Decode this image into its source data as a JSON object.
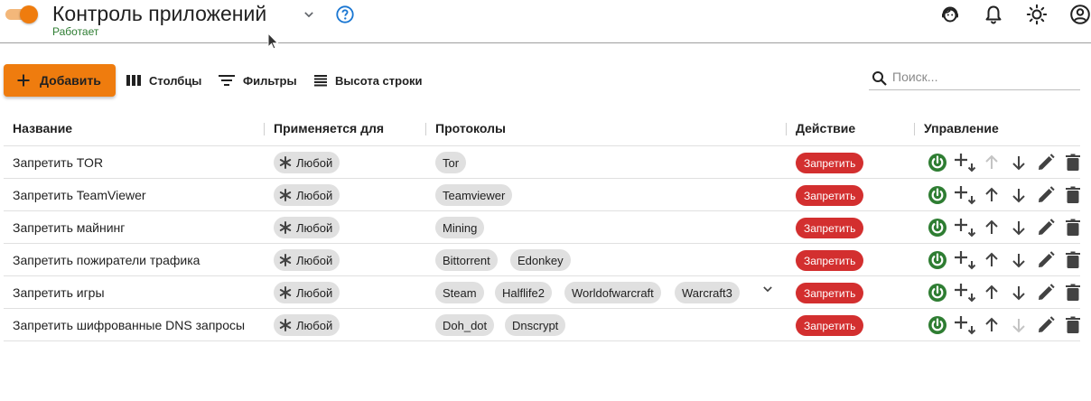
{
  "header": {
    "title": "Контроль приложений",
    "status": "Работает",
    "toggle_on": true,
    "icons": [
      "toggle-switch",
      "chevron-down-icon",
      "help-circle-icon",
      "support-agent-icon",
      "bell-icon",
      "brightness-icon",
      "account-icon"
    ]
  },
  "toolbar": {
    "add_label": "Добавить",
    "columns_label": "Столбцы",
    "filters_label": "Фильтры",
    "row_height_label": "Высота строки",
    "search_placeholder": "Поиск..."
  },
  "table": {
    "columns": [
      "Название",
      "Применяется для",
      "Протоколы",
      "Действие",
      "Управление"
    ],
    "rows": [
      {
        "name": "Запретить TOR",
        "applies_to": "Любой",
        "protocols": [
          "Tor"
        ],
        "action": "Запретить",
        "up_enabled": false,
        "down_enabled": true
      },
      {
        "name": "Запретить TeamViewer",
        "applies_to": "Любой",
        "protocols": [
          "Teamviewer"
        ],
        "action": "Запретить",
        "up_enabled": true,
        "down_enabled": true
      },
      {
        "name": "Запретить майнинг",
        "applies_to": "Любой",
        "protocols": [
          "Mining"
        ],
        "action": "Запретить",
        "up_enabled": true,
        "down_enabled": true
      },
      {
        "name": "Запретить пожиратели трафика",
        "applies_to": "Любой",
        "protocols": [
          "Bittorrent",
          "Edonkey"
        ],
        "action": "Запретить",
        "up_enabled": true,
        "down_enabled": true
      },
      {
        "name": "Запретить игры",
        "applies_to": "Любой",
        "protocols": [
          "Steam",
          "Halflife2",
          "Worldofwarcraft",
          "Warcraft3"
        ],
        "action": "Запретить",
        "up_enabled": true,
        "down_enabled": true,
        "expandable": true
      },
      {
        "name": "Запретить шифрованные DNS запросы",
        "applies_to": "Любой",
        "protocols": [
          "Doh_dot",
          "Dnscrypt"
        ],
        "action": "Запретить",
        "up_enabled": true,
        "down_enabled": false
      }
    ]
  },
  "colors": {
    "accent": "#ef7c0e",
    "status_green": "#2e7d32",
    "action_red": "#d32f2f",
    "help_blue": "#1976d2",
    "chip_gray": "#e0e0e0"
  }
}
